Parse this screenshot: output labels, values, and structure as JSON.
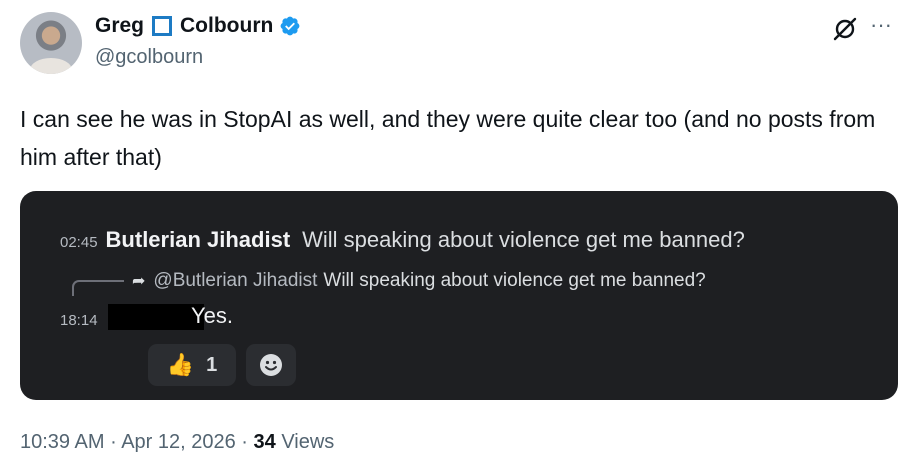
{
  "author": {
    "name_first": "Greg",
    "name_last": "Colbourn",
    "handle": "@gcolbourn",
    "verified_color": "#1d9bf0"
  },
  "post": {
    "text": "I can see he was in StopAI as well, and they were quite clear too (and no posts from him after that)"
  },
  "embed": {
    "message1": {
      "time": "02:45",
      "author": "Butlerian Jihadist",
      "text": "Will speaking about violence get me banned?"
    },
    "reply": {
      "mention": "@Butlerian Jihadist",
      "text": "Will speaking about violence get me banned?"
    },
    "message2": {
      "time": "18:14",
      "text": "Yes."
    },
    "reaction": {
      "emoji": "👍",
      "count": "1"
    },
    "background": "#1e1f22"
  },
  "meta": {
    "time": "10:39 AM",
    "separator": " · ",
    "date": "Apr 12, 2026",
    "views_count": "34",
    "views_label": "Views"
  },
  "icons": {
    "grok": "grok-icon",
    "more": "more-icon",
    "verified": "verified-badge-icon",
    "reply_arrow": "reply-arrow-icon",
    "add_reaction": "smiley-icon"
  }
}
